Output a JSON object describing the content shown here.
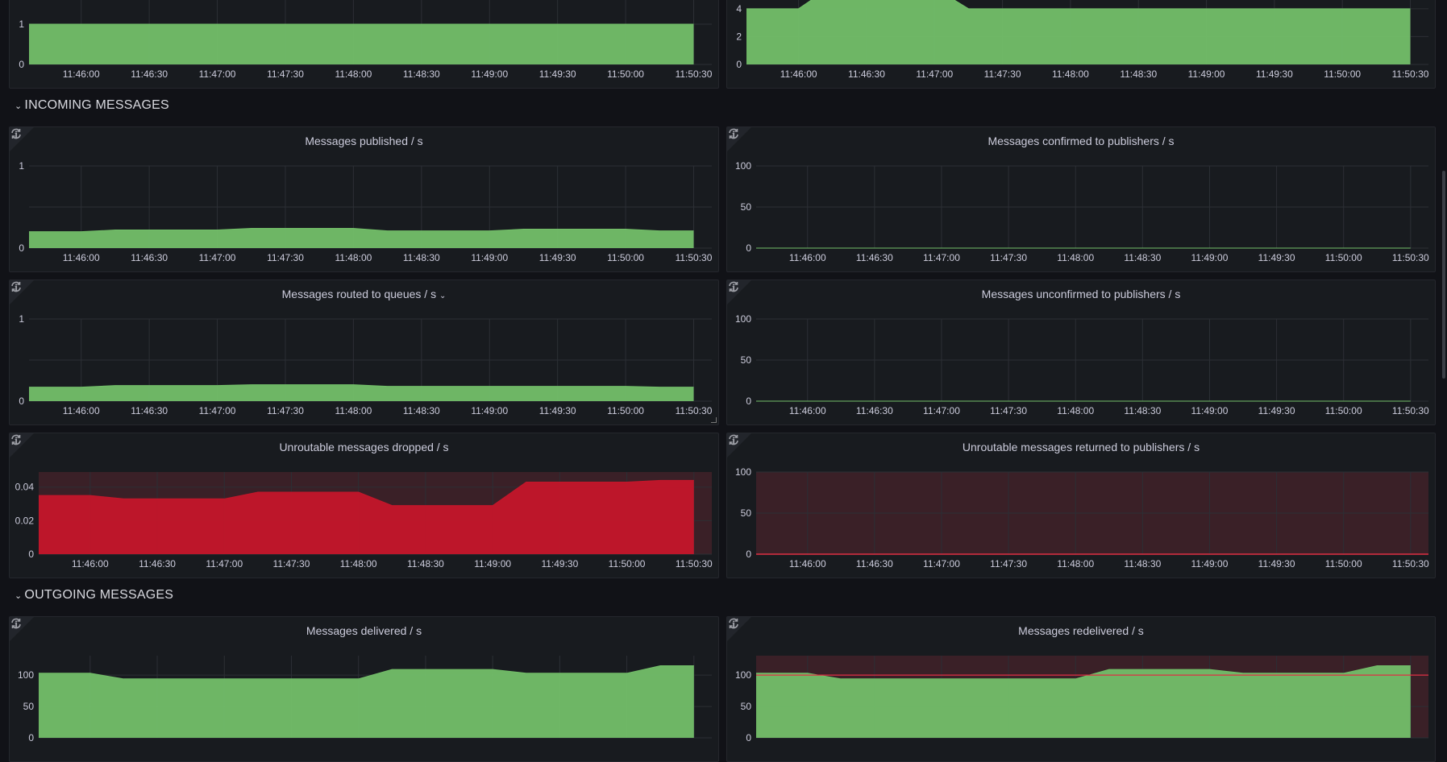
{
  "sections": {
    "incoming": "INCOMING MESSAGES",
    "outgoing": "OUTGOING MESSAGES",
    "chevron": "⌄"
  },
  "icons": {
    "info": "i",
    "refresh": "refresh-icon"
  },
  "colors": {
    "green": "#73bf69",
    "red": "#c4162a",
    "threshold_bg": "#3a2027",
    "threshold_line": "#e02f44"
  },
  "chart_data": [
    {
      "type": "area",
      "title": "",
      "color": "#73bf69",
      "ylim": [
        0,
        2.04
      ],
      "yticks": [
        {
          "v": 0,
          "label": "0"
        },
        {
          "v": 1,
          "label": "1"
        },
        {
          "v": 2,
          "label": ""
        }
      ],
      "xticks": [
        "11:46:00",
        "11:46:30",
        "11:47:00",
        "11:47:30",
        "11:48:00",
        "11:48:30",
        "11:49:00",
        "11:49:30",
        "11:50:00",
        "11:50:30"
      ],
      "points": [
        [
          "11:45:37",
          1
        ],
        [
          "11:50:30",
          1
        ]
      ]
    },
    {
      "type": "area",
      "title": "",
      "color": "#73bf69",
      "ylim": [
        0,
        5.9
      ],
      "yticks": [
        {
          "v": 0,
          "label": "0"
        },
        {
          "v": 2,
          "label": "2"
        },
        {
          "v": 4,
          "label": "4"
        }
      ],
      "xticks": [
        "11:46:00",
        "11:46:30",
        "11:47:00",
        "11:47:30",
        "11:48:00",
        "11:48:30",
        "11:49:00",
        "11:49:30",
        "11:50:00",
        "11:50:30"
      ],
      "points": [
        [
          "11:45:37",
          4
        ],
        [
          "11:46:00",
          4
        ],
        [
          "11:46:18",
          6
        ],
        [
          "11:46:55",
          6
        ],
        [
          "11:47:15",
          4
        ],
        [
          "11:50:30",
          4
        ]
      ]
    },
    {
      "type": "area",
      "title": "Messages published / s",
      "color": "#73bf69",
      "ylim": [
        0,
        1
      ],
      "yticks": [
        {
          "v": 0,
          "label": "0"
        },
        {
          "v": 0.5,
          "label": ""
        },
        {
          "v": 1,
          "label": "1"
        }
      ],
      "xticks": [
        "11:46:00",
        "11:46:30",
        "11:47:00",
        "11:47:30",
        "11:48:00",
        "11:48:30",
        "11:49:00",
        "11:49:30",
        "11:50:00",
        "11:50:30"
      ],
      "points": [
        [
          "11:45:37",
          0.2
        ],
        [
          "11:46:00",
          0.2
        ],
        [
          "11:46:15",
          0.22
        ],
        [
          "11:47:00",
          0.22
        ],
        [
          "11:47:15",
          0.24
        ],
        [
          "11:48:00",
          0.24
        ],
        [
          "11:48:15",
          0.21
        ],
        [
          "11:49:00",
          0.21
        ],
        [
          "11:49:15",
          0.23
        ],
        [
          "11:50:00",
          0.23
        ],
        [
          "11:50:15",
          0.21
        ],
        [
          "11:50:30",
          0.21
        ]
      ]
    },
    {
      "type": "area",
      "title": "Messages confirmed to publishers / s",
      "color": "#73bf69",
      "ylim": [
        0,
        100
      ],
      "yticks": [
        {
          "v": 0,
          "label": "0"
        },
        {
          "v": 50,
          "label": "50"
        },
        {
          "v": 100,
          "label": "100"
        }
      ],
      "xticks": [
        "11:46:00",
        "11:46:30",
        "11:47:00",
        "11:47:30",
        "11:48:00",
        "11:48:30",
        "11:49:00",
        "11:49:30",
        "11:50:00",
        "11:50:30"
      ],
      "points": [
        [
          "11:45:37",
          0
        ],
        [
          "11:50:30",
          0
        ]
      ]
    },
    {
      "type": "area",
      "title": "Messages routed to queues / s",
      "title_chevron": "⌄",
      "color": "#73bf69",
      "ylim": [
        0,
        1
      ],
      "yticks": [
        {
          "v": 0,
          "label": "0"
        },
        {
          "v": 0.5,
          "label": ""
        },
        {
          "v": 1,
          "label": "1"
        }
      ],
      "xticks": [
        "11:46:00",
        "11:46:30",
        "11:47:00",
        "11:47:30",
        "11:48:00",
        "11:48:30",
        "11:49:00",
        "11:49:30",
        "11:50:00",
        "11:50:30"
      ],
      "points": [
        [
          "11:45:37",
          0.17
        ],
        [
          "11:46:00",
          0.17
        ],
        [
          "11:46:15",
          0.19
        ],
        [
          "11:47:00",
          0.19
        ],
        [
          "11:47:15",
          0.2
        ],
        [
          "11:48:00",
          0.2
        ],
        [
          "11:48:15",
          0.18
        ],
        [
          "11:49:00",
          0.18
        ],
        [
          "11:49:15",
          0.18
        ],
        [
          "11:50:00",
          0.18
        ],
        [
          "11:50:15",
          0.17
        ],
        [
          "11:50:30",
          0.17
        ]
      ]
    },
    {
      "type": "area",
      "title": "Messages unconfirmed to publishers / s",
      "color": "#73bf69",
      "ylim": [
        0,
        100
      ],
      "yticks": [
        {
          "v": 0,
          "label": "0"
        },
        {
          "v": 50,
          "label": "50"
        },
        {
          "v": 100,
          "label": "100"
        }
      ],
      "xticks": [
        "11:46:00",
        "11:46:30",
        "11:47:00",
        "11:47:30",
        "11:48:00",
        "11:48:30",
        "11:49:00",
        "11:49:30",
        "11:50:00",
        "11:50:30"
      ],
      "points": [
        [
          "11:45:37",
          0
        ],
        [
          "11:50:30",
          0
        ]
      ]
    },
    {
      "type": "area",
      "title": "Unroutable messages dropped / s",
      "color": "#c4162a",
      "threshold_bg": true,
      "ylim": [
        0,
        0.049
      ],
      "yticks": [
        {
          "v": 0,
          "label": "0"
        },
        {
          "v": 0.02,
          "label": "0.02"
        },
        {
          "v": 0.04,
          "label": "0.04"
        }
      ],
      "xticks": [
        "11:46:00",
        "11:46:30",
        "11:47:00",
        "11:47:30",
        "11:48:00",
        "11:48:30",
        "11:49:00",
        "11:49:30",
        "11:50:00",
        "11:50:30"
      ],
      "points": [
        [
          "11:45:37",
          0.035
        ],
        [
          "11:46:00",
          0.035
        ],
        [
          "11:46:15",
          0.033
        ],
        [
          "11:47:00",
          0.033
        ],
        [
          "11:47:15",
          0.037
        ],
        [
          "11:48:00",
          0.037
        ],
        [
          "11:48:15",
          0.029
        ],
        [
          "11:49:00",
          0.029
        ],
        [
          "11:49:15",
          0.043
        ],
        [
          "11:50:00",
          0.043
        ],
        [
          "11:50:15",
          0.044
        ],
        [
          "11:50:30",
          0.044
        ]
      ]
    },
    {
      "type": "area",
      "title": "Unroutable messages returned to publishers / s",
      "color": "#c4162a",
      "threshold_bg": true,
      "ylim": [
        0,
        100
      ],
      "yticks": [
        {
          "v": 0,
          "label": "0"
        },
        {
          "v": 50,
          "label": "50"
        },
        {
          "v": 100,
          "label": "100"
        }
      ],
      "xticks": [
        "11:46:00",
        "11:46:30",
        "11:47:00",
        "11:47:30",
        "11:48:00",
        "11:48:30",
        "11:49:00",
        "11:49:30",
        "11:50:00",
        "11:50:30"
      ],
      "points": [
        [
          "11:45:37",
          0
        ],
        [
          "11:50:30",
          0
        ]
      ]
    },
    {
      "type": "area",
      "title": "Messages delivered / s",
      "color": "#73bf69",
      "ylim": [
        0,
        131
      ],
      "yticks": [
        {
          "v": 0,
          "label": "0"
        },
        {
          "v": 50,
          "label": "50"
        },
        {
          "v": 100,
          "label": "100"
        }
      ],
      "xticks": [],
      "points": [
        [
          "11:45:37",
          103
        ],
        [
          "11:46:00",
          103
        ],
        [
          "11:46:15",
          94
        ],
        [
          "11:48:00",
          94
        ],
        [
          "11:48:15",
          109
        ],
        [
          "11:49:00",
          109
        ],
        [
          "11:49:15",
          103
        ],
        [
          "11:50:00",
          103
        ],
        [
          "11:50:15",
          115
        ],
        [
          "11:50:30",
          115
        ]
      ]
    },
    {
      "type": "area",
      "title": "Messages redelivered / s",
      "color": "#73bf69",
      "threshold_bg": true,
      "threshold_line": 100,
      "ylim": [
        0,
        131
      ],
      "yticks": [
        {
          "v": 0,
          "label": "0"
        },
        {
          "v": 50,
          "label": "50"
        },
        {
          "v": 100,
          "label": "100"
        }
      ],
      "xticks": [],
      "points": [
        [
          "11:45:37",
          103
        ],
        [
          "11:46:00",
          103
        ],
        [
          "11:46:15",
          94
        ],
        [
          "11:48:00",
          94
        ],
        [
          "11:48:15",
          109
        ],
        [
          "11:49:00",
          109
        ],
        [
          "11:49:15",
          103
        ],
        [
          "11:50:00",
          103
        ],
        [
          "11:50:15",
          115
        ],
        [
          "11:50:30",
          115
        ]
      ]
    }
  ]
}
